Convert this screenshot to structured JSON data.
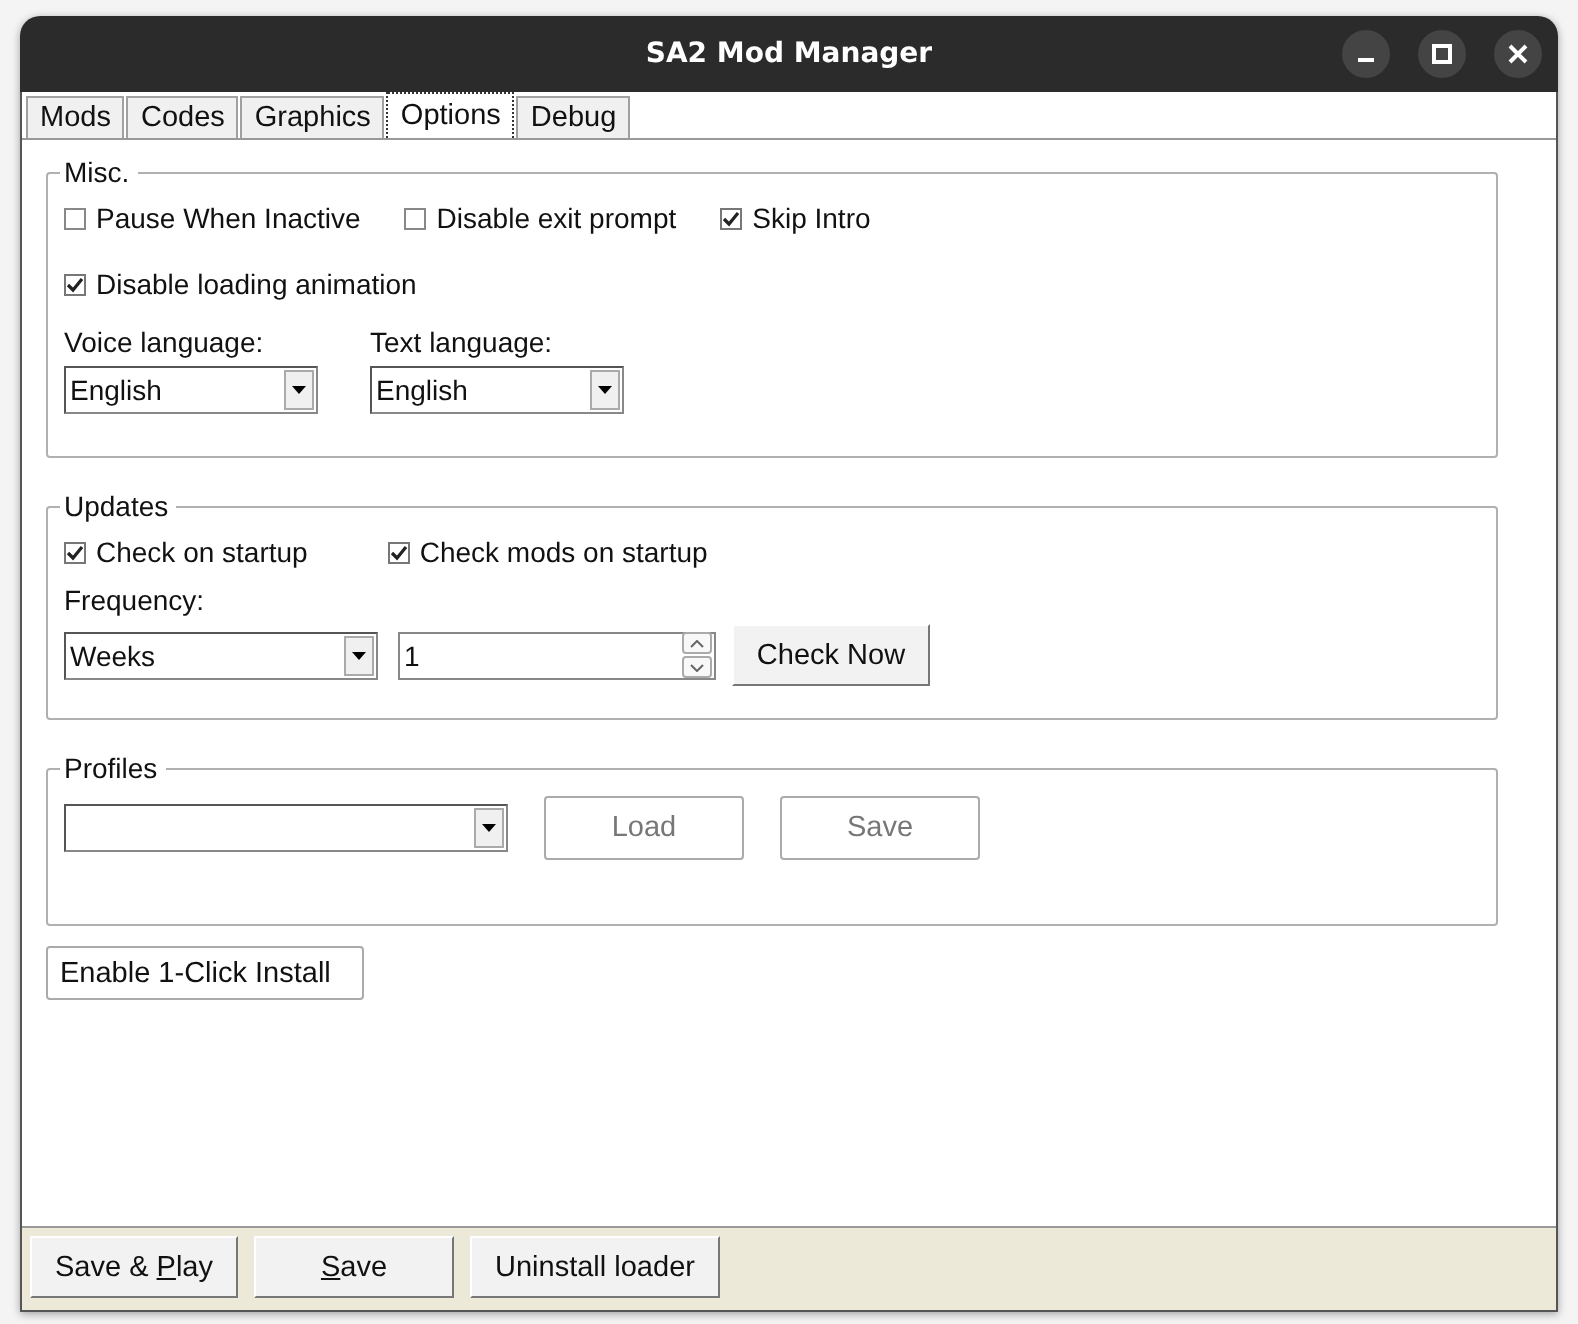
{
  "window": {
    "title": "SA2 Mod Manager"
  },
  "tabs": [
    {
      "label": "Mods",
      "selected": false
    },
    {
      "label": "Codes",
      "selected": false
    },
    {
      "label": "Graphics",
      "selected": false
    },
    {
      "label": "Options",
      "selected": true
    },
    {
      "label": "Debug",
      "selected": false
    }
  ],
  "misc": {
    "title": "Misc.",
    "checkboxes": [
      {
        "label": "Pause When Inactive",
        "checked": false
      },
      {
        "label": "Disable exit prompt",
        "checked": false
      },
      {
        "label": "Skip Intro",
        "checked": true
      },
      {
        "label": "Disable loading animation",
        "checked": true
      }
    ],
    "voice_language": {
      "label": "Voice language:",
      "value": "English"
    },
    "text_language": {
      "label": "Text language:",
      "value": "English"
    }
  },
  "updates": {
    "title": "Updates",
    "checkboxes": [
      {
        "label": "Check on startup",
        "checked": true
      },
      {
        "label": "Check mods on startup",
        "checked": true
      }
    ],
    "frequency": {
      "label": "Frequency:",
      "value": "Weeks"
    },
    "interval": {
      "value": "1"
    },
    "check_button": "Check Now"
  },
  "profiles": {
    "title": "Profiles",
    "load_button": {
      "label": "Load",
      "disabled": true
    },
    "save_button": {
      "label": "Save",
      "disabled": true
    }
  },
  "one_click_button": "Enable 1-Click Install",
  "footer_buttons": [
    {
      "text_before": "Save & ",
      "access_key": "P",
      "text_after": "lay"
    },
    {
      "access_key": "S",
      "text_after": "ave"
    },
    {
      "text_before": "Uninstall loader"
    }
  ]
}
